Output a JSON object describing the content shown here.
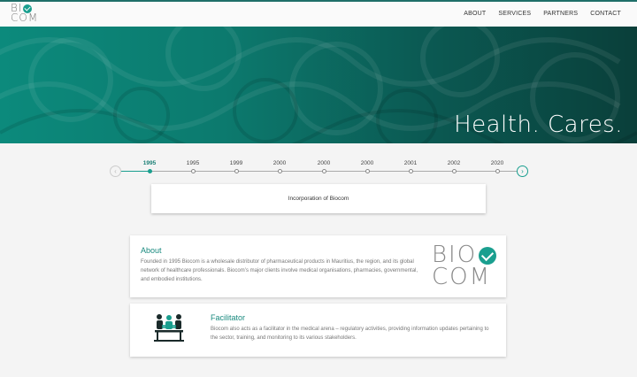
{
  "header": {
    "logo": {
      "line1": "BI",
      "line2": "COM"
    },
    "nav": [
      "ABOUT",
      "SERVICES",
      "PARTNERS",
      "CONTACT"
    ]
  },
  "hero": {
    "title": "Health. Cares."
  },
  "timeline": {
    "prev_icon": "chevron-left-icon",
    "next_icon": "chevron-right-icon",
    "years": [
      "1995",
      "1995",
      "1999",
      "2000",
      "2000",
      "2000",
      "2001",
      "2002",
      "2020"
    ],
    "active_index": 0,
    "event_text": "Incorporation of Biocom"
  },
  "about": {
    "title": "About",
    "body": "Founded in 1995 Biocom is a wholesale distributor of pharmaceutical products in Mauritius, the region, and its global network of healthcare professionals. Biocom’s major clients involve medical organisations, pharmacies, governmental, and embodied institutions.",
    "logo": {
      "line1": "BIO",
      "line2": "COM"
    }
  },
  "facilitator": {
    "title": "Facilitator",
    "body": "Biocom also acts as a facilitator in the medical arena – regulatory activities, providing information updates pertaining to the sector, training, and monitoring to its various stakeholders.",
    "icon": "meeting-table-icon"
  },
  "colors": {
    "accent": "#1a9f8f",
    "hero_dark": "#0a3f3a",
    "hero_light": "#0c8a7c"
  }
}
